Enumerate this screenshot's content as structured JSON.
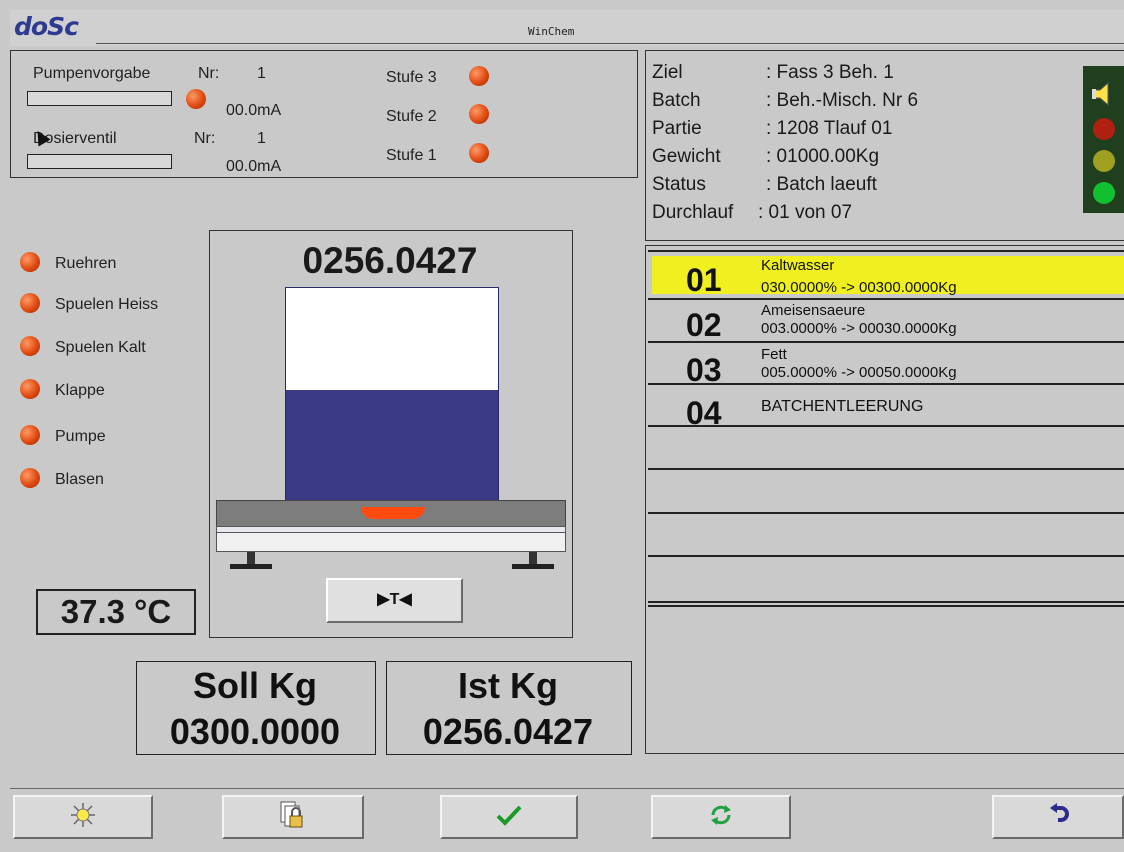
{
  "app": {
    "logo": "doSc",
    "title": "WinChem"
  },
  "control": {
    "pump_label": "Pumpenvorgabe",
    "pump_nr_label": "Nr:",
    "pump_nr": "1",
    "pump_current": "00.0mA",
    "valve_label": "Dosierventil",
    "valve_nr_label": "Nr:",
    "valve_nr": "1",
    "valve_current": "00.0mA",
    "stages": [
      "Stufe 3",
      "Stufe 2",
      "Stufe 1"
    ]
  },
  "batch_info": {
    "rows": [
      {
        "label": "Ziel",
        "value": ": Fass 3 Beh. 1"
      },
      {
        "label": "Batch",
        "value": ": Beh.-Misch. Nr 6"
      },
      {
        "label": "Partie",
        "value": ": 1208 Tlauf 01"
      },
      {
        "label": "Gewicht",
        "value": ": 01000.00Kg"
      },
      {
        "label": "Status",
        "value": ": Batch laeuft"
      },
      {
        "label": "Durchlauf",
        "value": ": 01 von 07"
      }
    ]
  },
  "status_lights": {
    "active": "green",
    "colors": {
      "red": "#b02010",
      "yellow": "#a0a020",
      "green": "#10c030",
      "housing": "#1f3f1f"
    }
  },
  "indicators": [
    "Ruehren",
    "Spuelen Heiss",
    "Spuelen Kalt",
    "Klappe",
    "Pumpe",
    "Blasen"
  ],
  "temperature": "37.3 °C",
  "scale": {
    "reading": "0256.0427",
    "fill_fraction": 0.52,
    "tare_label": "▶T◀"
  },
  "steps": [
    {
      "num": "01",
      "name": "Kaltwasser",
      "detail": "030.0000% -> 00300.0000Kg",
      "active": true
    },
    {
      "num": "02",
      "name": "Ameisensaeure",
      "detail": "003.0000% -> 00030.0000Kg",
      "active": false
    },
    {
      "num": "03",
      "name": "Fett",
      "detail": "005.0000% -> 00050.0000Kg",
      "active": false
    },
    {
      "num": "04",
      "name": "BATCHENTLEERUNG",
      "detail": "",
      "active": false
    }
  ],
  "totals": {
    "soll_label": "Soll Kg",
    "soll_value": "0300.0000",
    "ist_label": "Ist Kg",
    "ist_value": "0256.0427"
  },
  "colors": {
    "active_row": "#f0f020",
    "tank_fill": "#3a3a85",
    "scale_indicator": "#ff4a10"
  },
  "toolbar": {
    "icons": [
      "light-icon",
      "lock-icon",
      "checkmark-icon",
      "refresh-icon",
      "back-icon"
    ]
  }
}
